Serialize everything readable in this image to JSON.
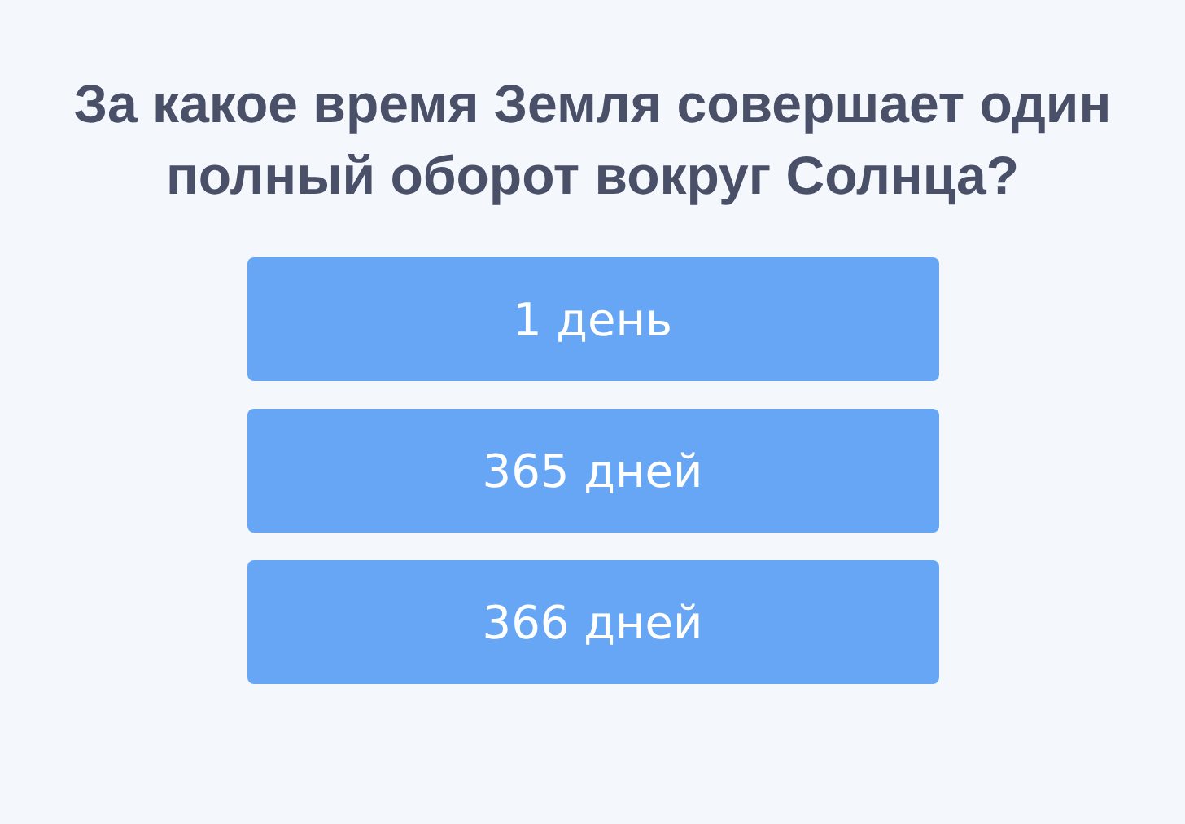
{
  "question": "За какое время Земля совершает один полный оборот вокруг Солнца?",
  "answers": [
    {
      "label": "1 день"
    },
    {
      "label": "365 дней"
    },
    {
      "label": "366 дней"
    }
  ]
}
